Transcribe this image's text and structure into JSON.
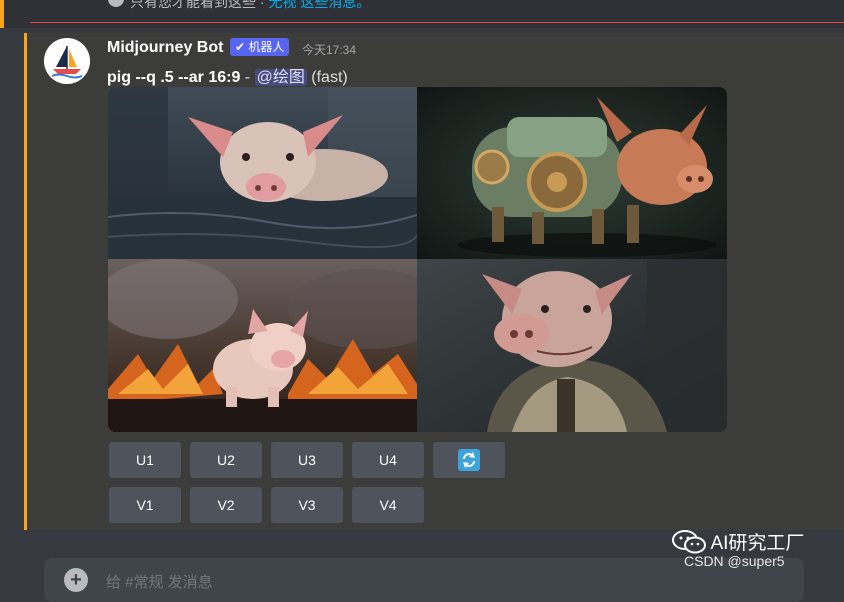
{
  "notice": {
    "text": "只有您才能看到这些 · ",
    "link": "无视 这些消息。"
  },
  "message": {
    "username": "Midjourney Bot",
    "badge": "✔ 机器人",
    "timestamp": "今天17:34",
    "prompt": "pig --q .5 --ar 16:9",
    "separator": " - ",
    "mention": "@绘图",
    "speed": " (fast)"
  },
  "images": [
    {
      "name": "pig-in-water"
    },
    {
      "name": "steampunk-pig"
    },
    {
      "name": "pig-in-fire"
    },
    {
      "name": "pig-in-vest"
    }
  ],
  "buttons": {
    "upscale": [
      "U1",
      "U2",
      "U3",
      "U4"
    ],
    "variation": [
      "V1",
      "V2",
      "V3",
      "V4"
    ],
    "reroll_icon": "refresh-icon"
  },
  "input": {
    "placeholder": "给 #常规 发消息"
  },
  "watermark": {
    "brand": "AI研究工厂",
    "credit": "CSDN @super5"
  },
  "colors": {
    "accent": "#faa61a",
    "brand": "#5865f2",
    "button": "#4f545c",
    "reroll": "#3ba5dc"
  }
}
